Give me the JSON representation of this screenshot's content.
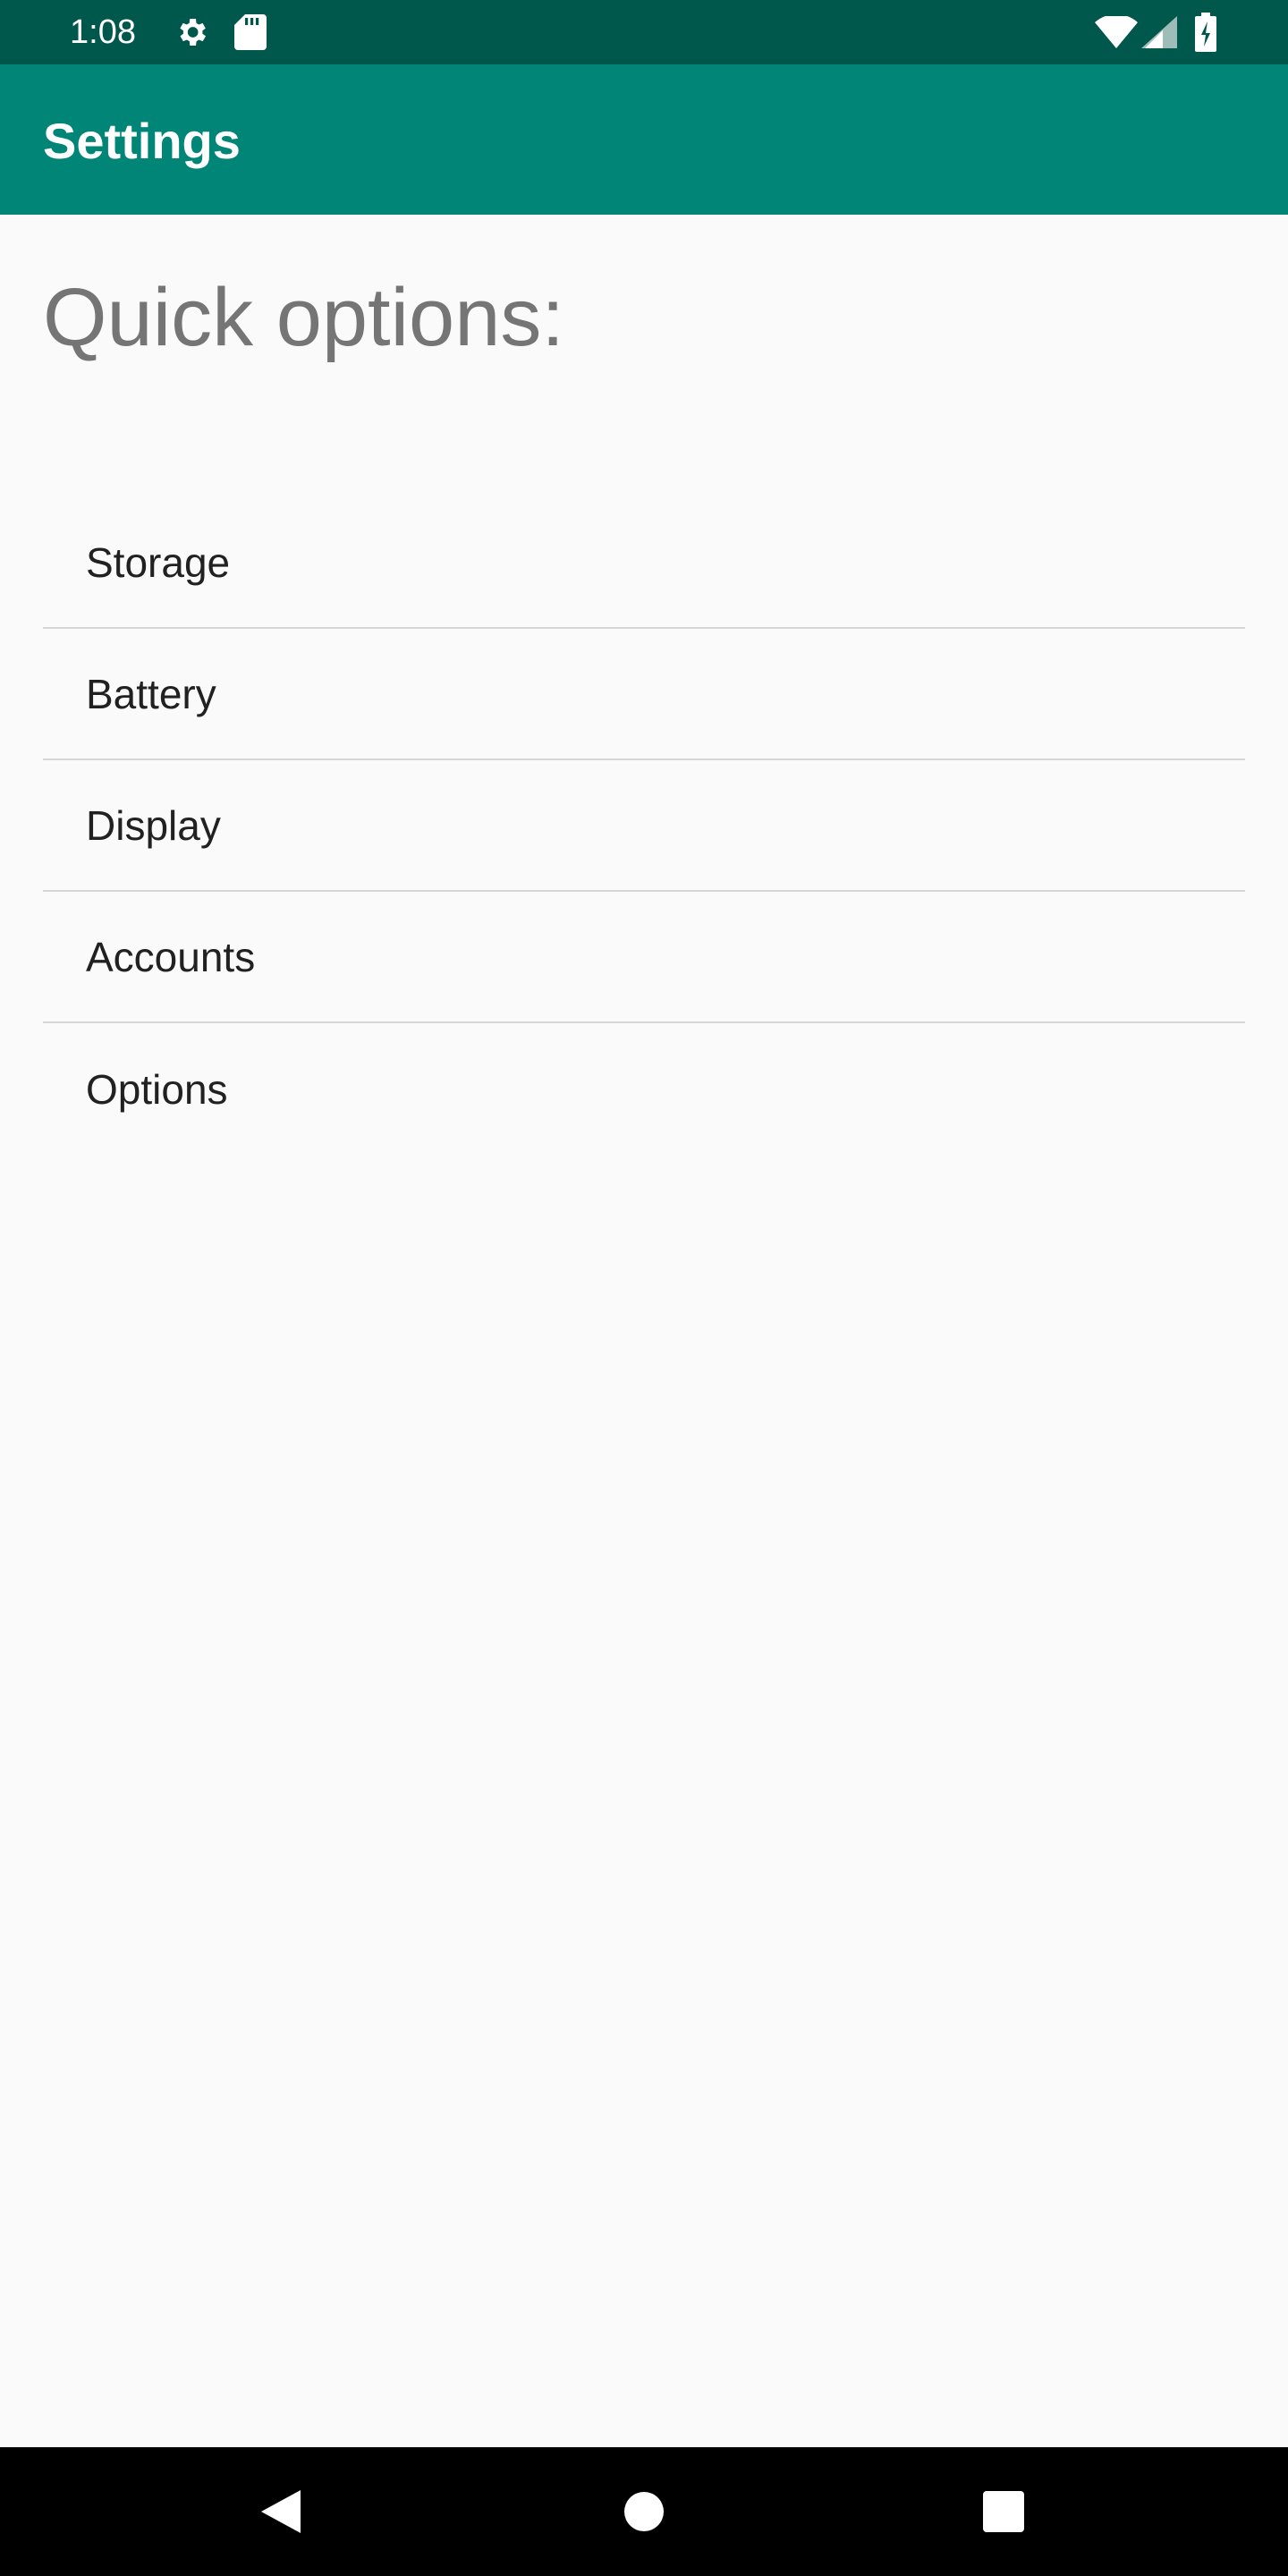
{
  "status_bar": {
    "time": "1:08",
    "icons": [
      "gear-icon",
      "sd-card-icon",
      "wifi-icon",
      "cell-signal-icon",
      "battery-charging-icon"
    ],
    "background_color": "#00574b"
  },
  "app_bar": {
    "title": "Settings",
    "background_color": "#008577"
  },
  "main": {
    "heading": "Quick options:",
    "options": [
      {
        "label": "Storage"
      },
      {
        "label": "Battery"
      },
      {
        "label": "Display"
      },
      {
        "label": "Accounts"
      },
      {
        "label": "Options"
      }
    ]
  },
  "nav_bar": {
    "buttons": [
      "back-icon",
      "home-icon",
      "recents-icon"
    ]
  }
}
